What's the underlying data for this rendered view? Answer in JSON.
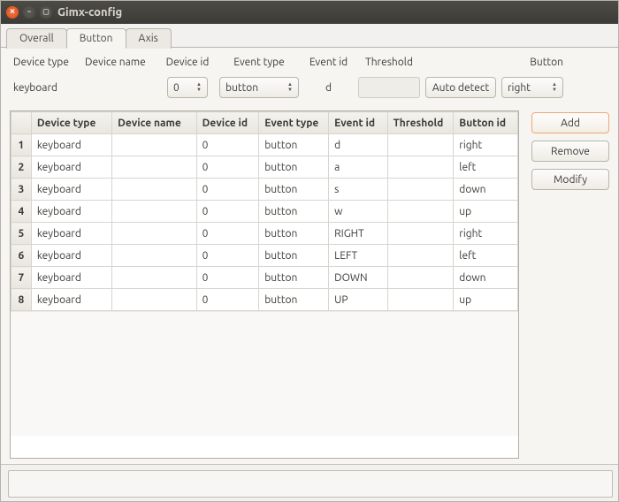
{
  "window": {
    "title": "Gimx-config"
  },
  "tabs": [
    {
      "label": "Overall"
    },
    {
      "label": "Button"
    },
    {
      "label": "Axis"
    }
  ],
  "active_tab": 1,
  "form": {
    "labels": {
      "device_type": "Device type",
      "device_name": "Device name",
      "device_id": "Device id",
      "event_type": "Event type",
      "event_id": "Event id",
      "threshold": "Threshold",
      "button": "Button"
    },
    "values": {
      "device_type": "keyboard",
      "device_name": "",
      "device_id": "0",
      "event_type": "button",
      "event_id": "d",
      "threshold": "",
      "auto_detect": "Auto detect",
      "button": "right"
    }
  },
  "columns": [
    "Device type",
    "Device name",
    "Device id",
    "Event type",
    "Event id",
    "Threshold",
    "Button id"
  ],
  "rows": [
    {
      "device_type": "keyboard",
      "device_name": "",
      "device_id": "0",
      "event_type": "button",
      "event_id": "d",
      "threshold": "",
      "button_id": "right"
    },
    {
      "device_type": "keyboard",
      "device_name": "",
      "device_id": "0",
      "event_type": "button",
      "event_id": "a",
      "threshold": "",
      "button_id": "left"
    },
    {
      "device_type": "keyboard",
      "device_name": "",
      "device_id": "0",
      "event_type": "button",
      "event_id": "s",
      "threshold": "",
      "button_id": "down"
    },
    {
      "device_type": "keyboard",
      "device_name": "",
      "device_id": "0",
      "event_type": "button",
      "event_id": "w",
      "threshold": "",
      "button_id": "up"
    },
    {
      "device_type": "keyboard",
      "device_name": "",
      "device_id": "0",
      "event_type": "button",
      "event_id": "RIGHT",
      "threshold": "",
      "button_id": "right"
    },
    {
      "device_type": "keyboard",
      "device_name": "",
      "device_id": "0",
      "event_type": "button",
      "event_id": "LEFT",
      "threshold": "",
      "button_id": "left"
    },
    {
      "device_type": "keyboard",
      "device_name": "",
      "device_id": "0",
      "event_type": "button",
      "event_id": "DOWN",
      "threshold": "",
      "button_id": "down"
    },
    {
      "device_type": "keyboard",
      "device_name": "",
      "device_id": "0",
      "event_type": "button",
      "event_id": "UP",
      "threshold": "",
      "button_id": "up"
    }
  ],
  "buttons": {
    "add": "Add",
    "remove": "Remove",
    "modify": "Modify"
  }
}
